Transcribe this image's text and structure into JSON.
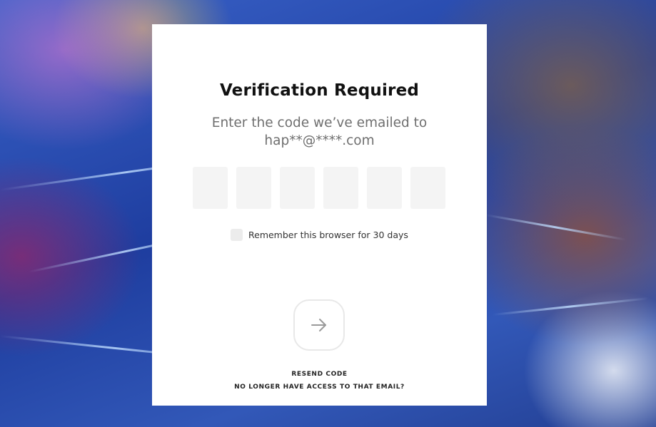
{
  "dialog": {
    "title": "Verification Required",
    "subtitle": "Enter the code we’ve emailed to hap**@****.com",
    "code_boxes": [
      "",
      "",
      "",
      "",
      "",
      ""
    ],
    "remember_label": "Remember this browser for 30 days",
    "remember_checked": false,
    "submit_icon": "arrow-right-icon",
    "resend_label": "RESEND CODE",
    "no_access_label": "NO LONGER HAVE ACCESS TO THAT EMAIL?"
  },
  "colors": {
    "background": "#1e3d9f",
    "card": "#ffffff",
    "input_fill": "#f4f4f4",
    "title": "#111111",
    "subtitle": "#6f6f6f"
  }
}
